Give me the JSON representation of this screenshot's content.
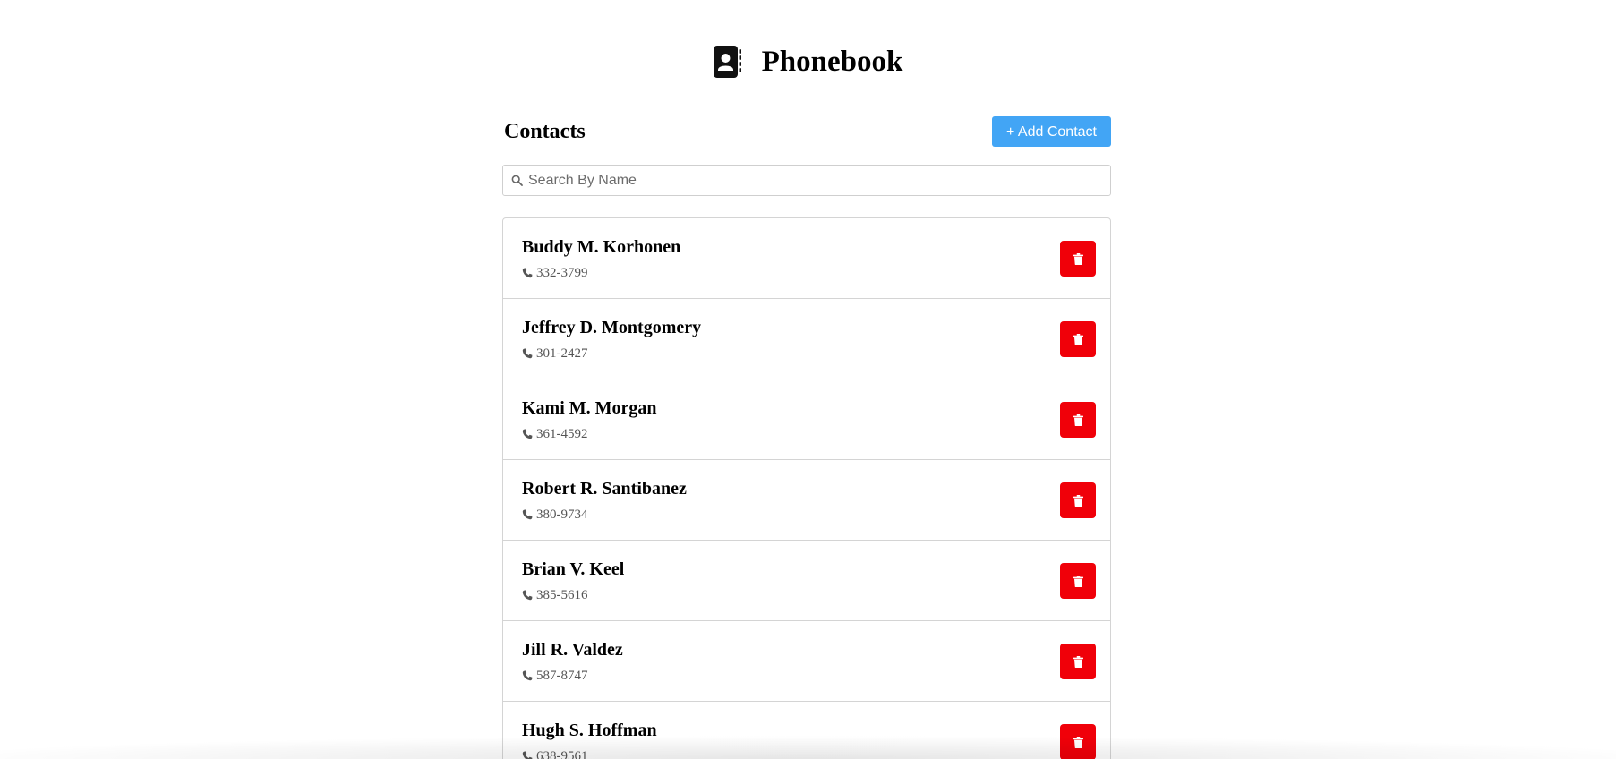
{
  "app": {
    "title": "Phonebook",
    "logo_icon": "address-book-icon"
  },
  "contacts_section": {
    "title": "Contacts",
    "add_button_label": "+ Add Contact",
    "add_button_color": "#42a5f5"
  },
  "search": {
    "placeholder": "Search By Name",
    "value": "",
    "icon": "search-icon"
  },
  "delete_button": {
    "icon": "trash-icon",
    "color": "#f00009"
  },
  "contacts": [
    {
      "name": "Buddy M. Korhonen",
      "phone": "332-3799"
    },
    {
      "name": "Jeffrey D. Montgomery",
      "phone": "301-2427"
    },
    {
      "name": "Kami M. Morgan",
      "phone": "361-4592"
    },
    {
      "name": "Robert R. Santibanez",
      "phone": "380-9734"
    },
    {
      "name": "Brian V. Keel",
      "phone": "385-5616"
    },
    {
      "name": "Jill R. Valdez",
      "phone": "587-8747"
    },
    {
      "name": "Hugh S. Hoffman",
      "phone": "638-9561"
    }
  ]
}
